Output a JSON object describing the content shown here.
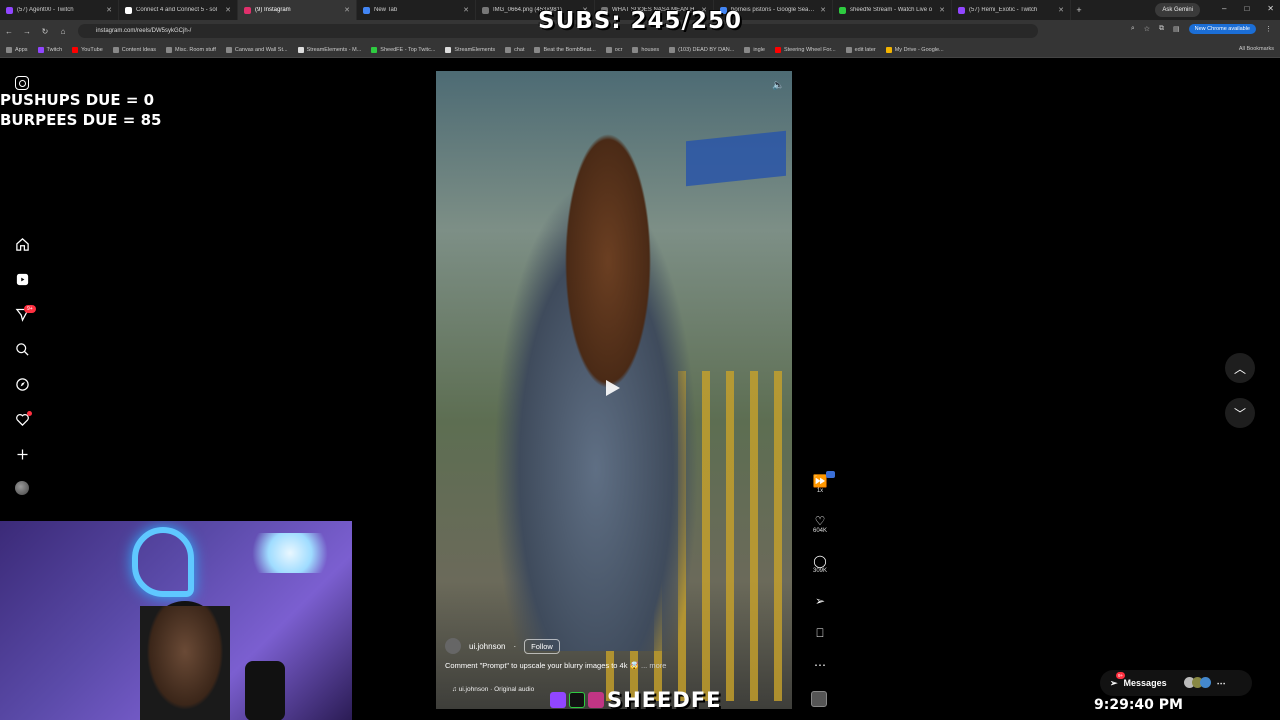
{
  "browser": {
    "tabs": [
      {
        "title": "(57) Agent00 - Twitch",
        "color": "#9146ff"
      },
      {
        "title": "Connect 4 and Connect 5 - sol",
        "color": "#ffffff"
      },
      {
        "title": "(9) Instagram",
        "color": "#e1306c",
        "active": true
      },
      {
        "title": "New Tab",
        "color": "#4285f4"
      },
      {
        "title": "IMG_0664.png (453×981)",
        "color": "#777777"
      },
      {
        "title": "WHAT SDOES NASA MEAN H",
        "color": "#777777"
      },
      {
        "title": "borneis pistons - Google Search",
        "color": "#4285f4"
      },
      {
        "title": "sheedfe Stream - Watch Live o",
        "color": "#2ecc40"
      },
      {
        "title": "(57) Remi_Exotic - Twitch",
        "color": "#9146ff"
      }
    ],
    "ask_gemini": "Ask Gemini",
    "url": "instagram.com/reels/DW5sykGCjh-/",
    "update_label": "New Chrome available",
    "bookmarks": [
      {
        "label": "Apps",
        "color": "#888888"
      },
      {
        "label": "Twitch",
        "color": "#9146ff"
      },
      {
        "label": "YouTube",
        "color": "#ff0000"
      },
      {
        "label": "Content Ideas",
        "color": "#888888"
      },
      {
        "label": "Misc. Room stuff",
        "color": "#888888"
      },
      {
        "label": "Canvas and Wall St...",
        "color": "#888888"
      },
      {
        "label": "StreamElements - M...",
        "color": "#dddddd"
      },
      {
        "label": "SheedFE - Top Twitc...",
        "color": "#2ecc40"
      },
      {
        "label": "StreamElements",
        "color": "#dddddd"
      },
      {
        "label": "chat",
        "color": "#888888"
      },
      {
        "label": "Beat the BombBeat...",
        "color": "#888888"
      },
      {
        "label": "ocr",
        "color": "#888888"
      },
      {
        "label": "houses",
        "color": "#888888"
      },
      {
        "label": "(103) DEAD BY DAN...",
        "color": "#888888"
      },
      {
        "label": "ingle",
        "color": "#888888"
      },
      {
        "label": "Steering Wheel For...",
        "color": "#ff0000"
      },
      {
        "label": "edit later",
        "color": "#888888"
      },
      {
        "label": "My Drive - Google...",
        "color": "#f4b400"
      }
    ],
    "all_bookmarks": "All Bookmarks"
  },
  "overlay": {
    "subs": "SUBS: 245/250",
    "pushups": "PUSHUPS DUE = 0",
    "burpees": "BURPEES DUE = 85",
    "streamer_name": "SHEEDFE",
    "clock": "9:29:40 PM"
  },
  "sidebar": {
    "notifications_badge": "9+",
    "icons": [
      "home-icon",
      "reels-icon",
      "messages-icon",
      "search-icon",
      "explore-icon",
      "heart-icon",
      "create-icon",
      "profile-icon"
    ]
  },
  "reel": {
    "username": "ui.johnson",
    "follow": "Follow",
    "caption": "Comment \"Prompt\" to upscale your blurry images to 4k 🤯",
    "more": "... more",
    "audio": "ui.johnson · Original audio"
  },
  "actions": {
    "speed": "1x",
    "likes": "604K",
    "comments": "309K"
  },
  "messages": {
    "label": "Messages",
    "badge": "9+"
  }
}
